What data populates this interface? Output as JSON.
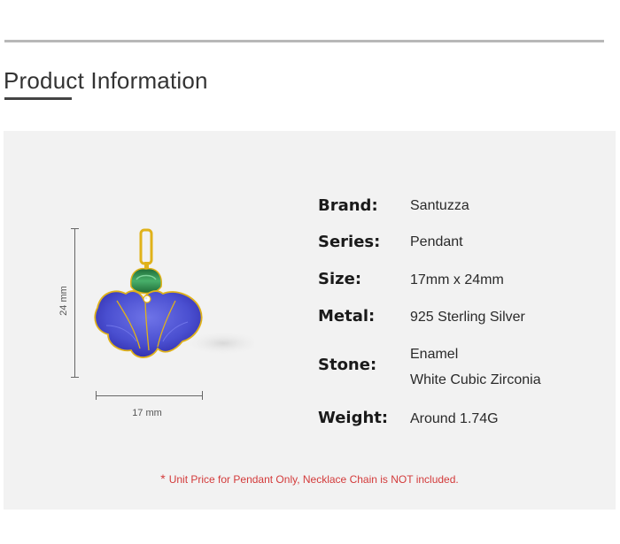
{
  "section": {
    "title": "Product Information"
  },
  "dimensions": {
    "height": "24 mm",
    "width": "17 mm"
  },
  "specs": {
    "brand": {
      "label": "Brand:",
      "value": "Santuzza"
    },
    "series": {
      "label": "Series:",
      "value": "Pendant"
    },
    "size": {
      "label": "Size:",
      "value": "17mm x 24mm"
    },
    "metal": {
      "label": "Metal:",
      "value": "925 Sterling Silver"
    },
    "stone": {
      "label": "Stone:",
      "values": [
        "Enamel",
        "White Cubic Zirconia"
      ]
    },
    "weight": {
      "label": "Weight:",
      "value": "Around 1.74G"
    }
  },
  "note": {
    "asterisk": "*",
    "text": "Unit Price for Pendant Only, Necklace Chain is NOT included."
  },
  "colors": {
    "petal_blue": "#4a4fd0",
    "petal_dark": "#2e2aa8",
    "leaf_green": "#2f8a4c",
    "gold": "#e0b21a",
    "note_red": "#d33a3a"
  }
}
